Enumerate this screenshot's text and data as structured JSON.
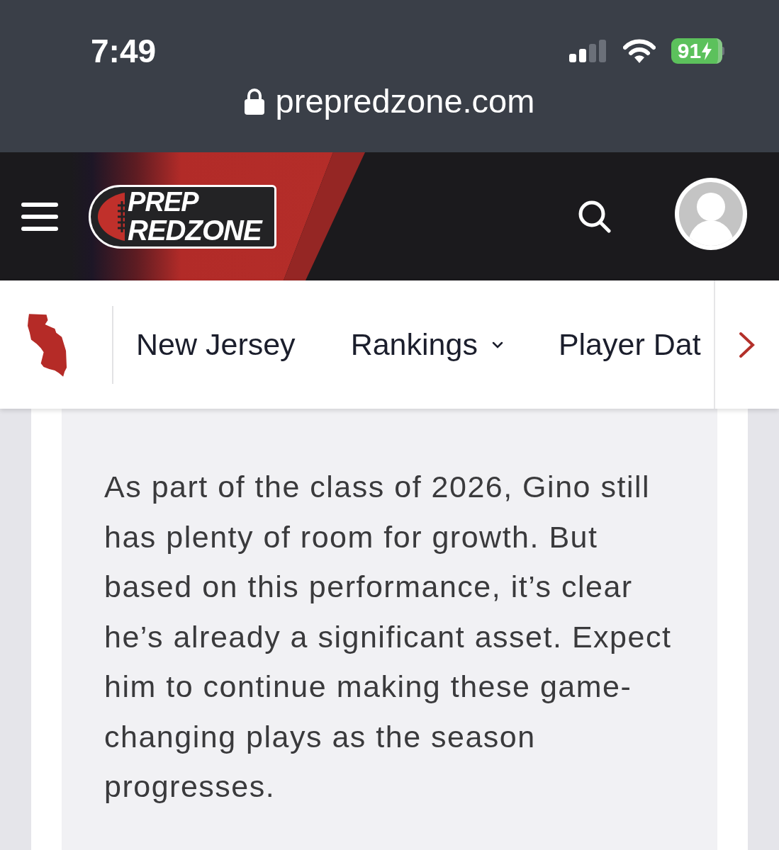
{
  "status_bar": {
    "time": "7:49",
    "battery": "91",
    "charging": true
  },
  "address_bar": {
    "url": "prepredzone.com"
  },
  "header": {
    "logo": {
      "line_1": "PREP",
      "line_2": "REDZONE"
    }
  },
  "nav": {
    "items": [
      {
        "label": "New Jersey",
        "dropdown": false
      },
      {
        "label": "Rankings",
        "dropdown": true
      },
      {
        "label": "Player Dat",
        "dropdown": false
      }
    ]
  },
  "article": {
    "paragraphs": [
      "As part of the class of 2026, Gino still has plenty of room for growth. But based on this performance, it’s clear he’s already a significant asset. Expect him to continue making these game-changing plays as the season progresses."
    ]
  }
}
